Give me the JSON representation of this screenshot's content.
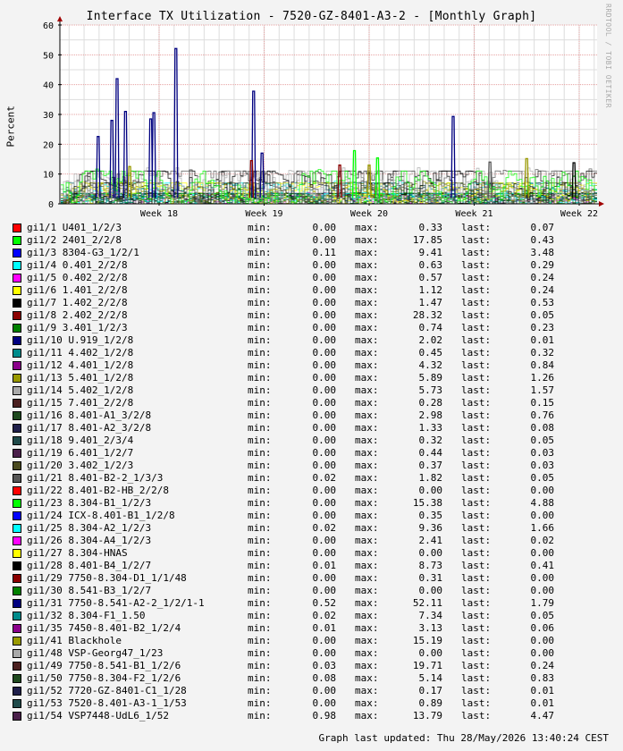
{
  "title": "Interface TX Utilization - 7520-GZ-8401-A3-2 - [Monthly Graph]",
  "watermark": "RRDTOOL / TOBI OETIKER",
  "footer": "Graph last updated: Thu 28/May/2026 13:40:24 CEST",
  "labels": {
    "min": "min:",
    "max": "max:",
    "last": "last:"
  },
  "chart_data": {
    "type": "line",
    "title": "Interface TX Utilization - 7520-GZ-8401-A3-2 - [Monthly Graph]",
    "ylabel": "Percent",
    "xlabel": "",
    "ylim": [
      0,
      60
    ],
    "yticks": [
      0,
      10,
      20,
      30,
      40,
      50,
      60
    ],
    "xtick_labels": [
      "Week 18",
      "Week 19",
      "Week 20",
      "Week 21",
      "Week 22"
    ],
    "grid": true,
    "legend_position": "bottom",
    "peaks": [
      {
        "color": "#000080",
        "week": 17.42,
        "value": 22.6
      },
      {
        "color": "#000080",
        "week": 17.6,
        "value": 42.0
      },
      {
        "color": "#000080",
        "week": 17.55,
        "value": 28.0
      },
      {
        "color": "#000080",
        "week": 17.68,
        "value": 31.0
      },
      {
        "color": "#000080",
        "week": 17.92,
        "value": 28.5
      },
      {
        "color": "#000080",
        "week": 17.95,
        "value": 30.6
      },
      {
        "color": "#000080",
        "week": 18.16,
        "value": 52.11
      },
      {
        "color": "#000080",
        "week": 18.9,
        "value": 37.8
      },
      {
        "color": "#000080",
        "week": 18.98,
        "value": 17.0
      },
      {
        "color": "#000080",
        "week": 20.8,
        "value": 29.3
      },
      {
        "color": "#00ff00",
        "week": 19.86,
        "value": 17.85
      },
      {
        "color": "#00ff00",
        "week": 20.08,
        "value": 15.38
      },
      {
        "color": "#999900",
        "week": 17.72,
        "value": 12.5
      },
      {
        "color": "#999900",
        "week": 21.5,
        "value": 15.19
      },
      {
        "color": "#555555",
        "week": 21.15,
        "value": 14.0
      },
      {
        "color": "#8b0000",
        "week": 18.88,
        "value": 14.5
      },
      {
        "color": "#8b0000",
        "week": 19.72,
        "value": 13.0
      },
      {
        "color": "#000000",
        "week": 21.95,
        "value": 13.79
      },
      {
        "color": "#999900",
        "week": 20.0,
        "value": 13.0
      }
    ],
    "series": [
      {
        "name": "gi1/1 U401_1/2/3",
        "color": "#ff0000",
        "min": "0.00",
        "max": "0.33",
        "last": "0.07"
      },
      {
        "name": "gi1/2 2401_2/2/8",
        "color": "#00ff00",
        "min": "0.00",
        "max": "17.85",
        "last": "0.43"
      },
      {
        "name": "gi1/3 8304-G3_1/2/1",
        "color": "#0000ff",
        "min": "0.11",
        "max": "9.41",
        "last": "3.48"
      },
      {
        "name": "gi1/4 0.401_2/2/8",
        "color": "#00ffff",
        "min": "0.00",
        "max": "0.63",
        "last": "0.29"
      },
      {
        "name": "gi1/5 0.402_2/2/8",
        "color": "#ff00ff",
        "min": "0.00",
        "max": "0.57",
        "last": "0.24"
      },
      {
        "name": "gi1/6 1.401_2/2/8",
        "color": "#ffff00",
        "min": "0.00",
        "max": "1.12",
        "last": "0.24"
      },
      {
        "name": "gi1/7 1.402_2/2/8",
        "color": "#000000",
        "min": "0.00",
        "max": "1.47",
        "last": "0.53"
      },
      {
        "name": "gi1/8 2.402_2/2/8",
        "color": "#8b0000",
        "min": "0.00",
        "max": "28.32",
        "last": "0.05"
      },
      {
        "name": "gi1/9 3.401_1/2/3",
        "color": "#008000",
        "min": "0.00",
        "max": "0.74",
        "last": "0.23"
      },
      {
        "name": "gi1/10 U.919_1/2/8",
        "color": "#000080",
        "min": "0.00",
        "max": "2.02",
        "last": "0.01"
      },
      {
        "name": "gi1/11 4.402_1/2/8",
        "color": "#008b8b",
        "min": "0.00",
        "max": "0.45",
        "last": "0.32"
      },
      {
        "name": "gi1/12 4.401_1/2/8",
        "color": "#8b008b",
        "min": "0.00",
        "max": "4.32",
        "last": "0.84"
      },
      {
        "name": "gi1/13 5.401_1/2/8",
        "color": "#999900",
        "min": "0.00",
        "max": "5.89",
        "last": "1.26"
      },
      {
        "name": "gi1/14 5.402_1/2/8",
        "color": "#a9a9a9",
        "min": "0.00",
        "max": "5.73",
        "last": "1.57"
      },
      {
        "name": "gi1/15 7.401_2/2/8",
        "color": "#4a1f1f",
        "min": "0.00",
        "max": "0.28",
        "last": "0.15"
      },
      {
        "name": "gi1/16 8.401-A1_3/2/8",
        "color": "#1f4a1f",
        "min": "0.00",
        "max": "2.98",
        "last": "0.76"
      },
      {
        "name": "gi1/17 8.401-A2_3/2/8",
        "color": "#1f1f4a",
        "min": "0.00",
        "max": "1.33",
        "last": "0.08"
      },
      {
        "name": "gi1/18 9.401_2/3/4",
        "color": "#1f4a4a",
        "min": "0.00",
        "max": "0.32",
        "last": "0.05"
      },
      {
        "name": "gi1/19 6.401_1/2/7",
        "color": "#4a1f4a",
        "min": "0.00",
        "max": "0.44",
        "last": "0.03"
      },
      {
        "name": "gi1/20 3.402_1/2/3",
        "color": "#4a4a1f",
        "min": "0.00",
        "max": "0.37",
        "last": "0.03"
      },
      {
        "name": "gi1/21 8.401-B2-2_1/3/3",
        "color": "#555555",
        "min": "0.02",
        "max": "1.82",
        "last": "0.05"
      },
      {
        "name": "gi1/22 8.401-B2-HB_2/2/8",
        "color": "#ff0000",
        "min": "0.00",
        "max": "0.00",
        "last": "0.00"
      },
      {
        "name": "gi1/23 8.304-B1_1/2/3",
        "color": "#00ff00",
        "min": "0.00",
        "max": "15.38",
        "last": "4.88"
      },
      {
        "name": "gi1/24 ICX-8.401-B1_1/2/8",
        "color": "#0000ff",
        "min": "0.00",
        "max": "0.35",
        "last": "0.00"
      },
      {
        "name": "gi1/25 8.304-A2_1/2/3",
        "color": "#00ffff",
        "min": "0.02",
        "max": "9.36",
        "last": "1.66"
      },
      {
        "name": "gi1/26 8.304-A4_1/2/3",
        "color": "#ff00ff",
        "min": "0.00",
        "max": "2.41",
        "last": "0.02"
      },
      {
        "name": "gi1/27 8.304-HNAS",
        "color": "#ffff00",
        "min": "0.00",
        "max": "0.00",
        "last": "0.00"
      },
      {
        "name": "gi1/28 8.401-B4_1/2/7",
        "color": "#000000",
        "min": "0.01",
        "max": "8.73",
        "last": "0.41"
      },
      {
        "name": "gi1/29 7750-8.304-D1_1/1/48",
        "color": "#8b0000",
        "min": "0.00",
        "max": "0.31",
        "last": "0.00"
      },
      {
        "name": "gi1/30 8.541-B3_1/2/7",
        "color": "#008000",
        "min": "0.00",
        "max": "0.00",
        "last": "0.00"
      },
      {
        "name": "gi1/31 7750-8.541-A2-2_1/2/1-1",
        "color": "#000080",
        "min": "0.52",
        "max": "52.11",
        "last": "1.79"
      },
      {
        "name": "gi1/32 8.304-F1_1.50",
        "color": "#008b8b",
        "min": "0.02",
        "max": "7.34",
        "last": "0.05"
      },
      {
        "name": "gi1/35 7450-8.401-B2_1/2/4",
        "color": "#8b008b",
        "min": "0.01",
        "max": "3.13",
        "last": "0.06"
      },
      {
        "name": "gi1/41 Blackhole",
        "color": "#999900",
        "min": "0.00",
        "max": "15.19",
        "last": "0.00"
      },
      {
        "name": "gi1/48 VSP-Georg47_1/23",
        "color": "#a9a9a9",
        "min": "0.00",
        "max": "0.00",
        "last": "0.00"
      },
      {
        "name": "gi1/49 7750-8.541-B1_1/2/6",
        "color": "#4a1f1f",
        "min": "0.03",
        "max": "19.71",
        "last": "0.24"
      },
      {
        "name": "gi1/50 7750-8.304-F2_1/2/6",
        "color": "#1f4a1f",
        "min": "0.08",
        "max": "5.14",
        "last": "0.83"
      },
      {
        "name": "gi1/52 7720-GZ-8401-C1_1/28",
        "color": "#1f1f4a",
        "min": "0.00",
        "max": "0.17",
        "last": "0.01"
      },
      {
        "name": "gi1/53 7520-8.401-A3-1_1/53",
        "color": "#1f4a4a",
        "min": "0.00",
        "max": "0.89",
        "last": "0.01"
      },
      {
        "name": "gi1/54 VSP7448-UdL6_1/52",
        "color": "#4a1f4a",
        "min": "0.98",
        "max": "13.79",
        "last": "4.47"
      }
    ]
  }
}
